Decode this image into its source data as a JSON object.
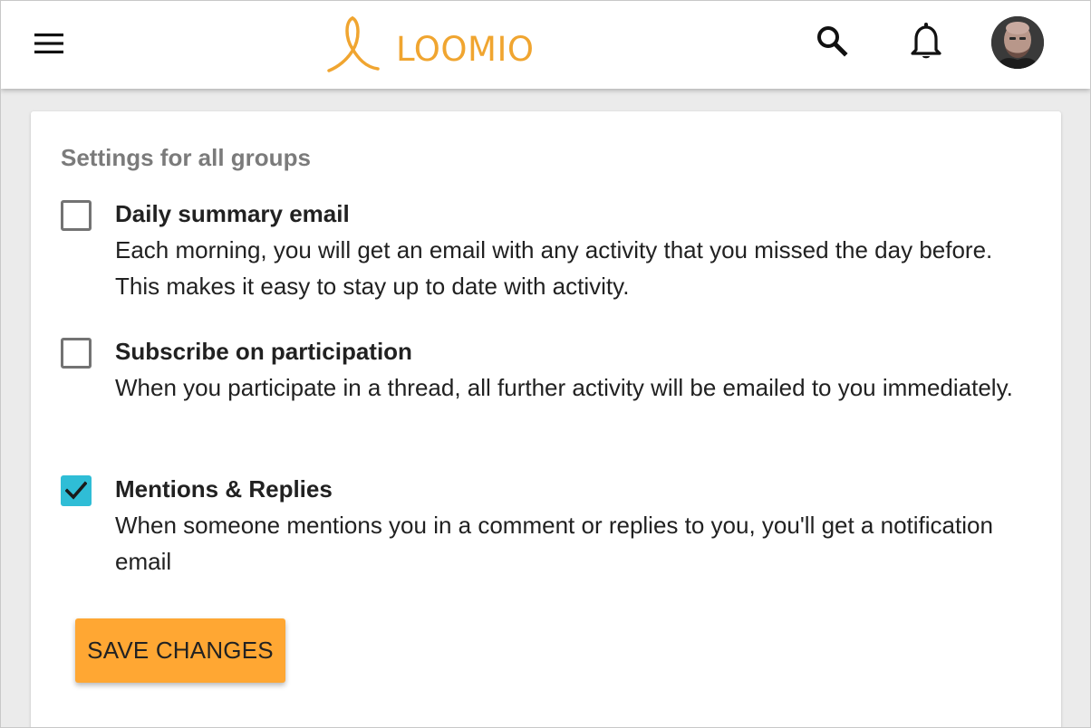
{
  "header": {
    "menu_icon": "hamburger-menu-icon",
    "logo_text": "LOOMIO",
    "brand_color": "#f0a530",
    "search_icon": "search-icon",
    "notifications_icon": "bell-icon",
    "avatar": "user-avatar"
  },
  "settings": {
    "section_title": "Settings for all groups",
    "options": [
      {
        "label": "Daily summary email",
        "description": "Each morning, you will get an email with any activity that you missed the day before. This makes it easy to stay up to date with activity.",
        "checked": false
      },
      {
        "label": "Subscribe on participation",
        "description": "When you participate in a thread, all further activity will be emailed to you immediately.",
        "checked": false
      },
      {
        "label": "Mentions & Replies",
        "description": "When someone mentions you in a comment or replies to you, you'll get a notification email",
        "checked": true
      }
    ],
    "checkbox_checked_color": "#2fbdd6",
    "save_label": "SAVE CHANGES",
    "save_color": "#ffa733"
  }
}
